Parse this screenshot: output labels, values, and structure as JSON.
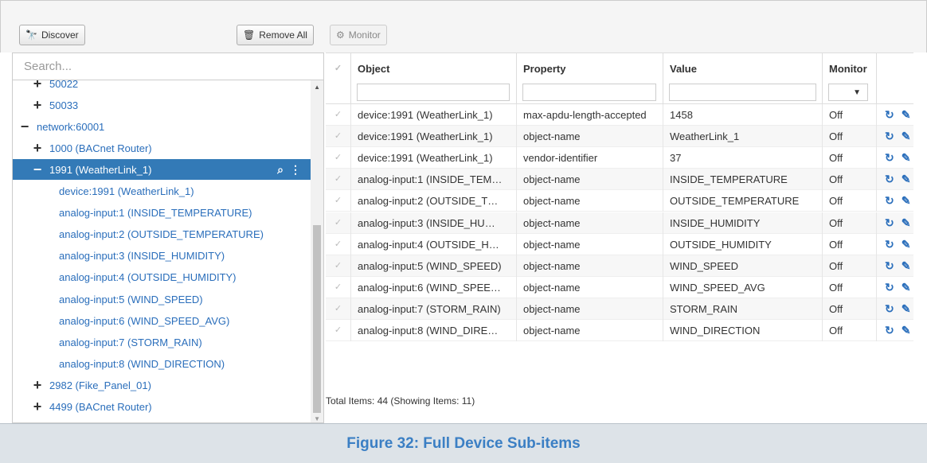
{
  "toolbar": {
    "discover_label": "Discover",
    "remove_all_label": "Remove All",
    "monitor_label": "Monitor"
  },
  "search": {
    "placeholder": "Search..."
  },
  "tree": {
    "items": [
      {
        "label": "50022",
        "type": "plus"
      },
      {
        "label": "50033",
        "type": "plus"
      },
      {
        "label": "network:60001",
        "type": "minus"
      },
      {
        "label": "1000 (BACnet Router)",
        "type": "plus"
      },
      {
        "label": "1991 (WeatherLink_1)",
        "type": "minus",
        "selected": true
      },
      {
        "label": "device:1991 (WeatherLink_1)",
        "type": "leaf"
      },
      {
        "label": "analog-input:1 (INSIDE_TEMPERATURE)",
        "type": "leaf"
      },
      {
        "label": "analog-input:2 (OUTSIDE_TEMPERATURE)",
        "type": "leaf"
      },
      {
        "label": "analog-input:3 (INSIDE_HUMIDITY)",
        "type": "leaf"
      },
      {
        "label": "analog-input:4 (OUTSIDE_HUMIDITY)",
        "type": "leaf"
      },
      {
        "label": "analog-input:5 (WIND_SPEED)",
        "type": "leaf"
      },
      {
        "label": "analog-input:6 (WIND_SPEED_AVG)",
        "type": "leaf"
      },
      {
        "label": "analog-input:7 (STORM_RAIN)",
        "type": "leaf"
      },
      {
        "label": "analog-input:8 (WIND_DIRECTION)",
        "type": "leaf"
      },
      {
        "label": "2982 (Fike_Panel_01)",
        "type": "plus"
      },
      {
        "label": "4499 (BACnet Router)",
        "type": "plus"
      }
    ]
  },
  "grid": {
    "columns": {
      "object": "Object",
      "property": "Property",
      "value": "Value",
      "monitor": "Monitor"
    },
    "rows": [
      {
        "object": "device:1991 (WeatherLink_1)",
        "property": "max-apdu-length-accepted",
        "value": "1458",
        "monitor": "Off"
      },
      {
        "object": "device:1991 (WeatherLink_1)",
        "property": "object-name",
        "value": "WeatherLink_1",
        "monitor": "Off"
      },
      {
        "object": "device:1991 (WeatherLink_1)",
        "property": "vendor-identifier",
        "value": "37",
        "monitor": "Off"
      },
      {
        "object": "analog-input:1 (INSIDE_TEM…",
        "property": "object-name",
        "value": "INSIDE_TEMPERATURE",
        "monitor": "Off"
      },
      {
        "object": "analog-input:2 (OUTSIDE_T…",
        "property": "object-name",
        "value": "OUTSIDE_TEMPERATURE",
        "monitor": "Off"
      },
      {
        "object": "analog-input:3 (INSIDE_HU…",
        "property": "object-name",
        "value": "INSIDE_HUMIDITY",
        "monitor": "Off"
      },
      {
        "object": "analog-input:4 (OUTSIDE_H…",
        "property": "object-name",
        "value": "OUTSIDE_HUMIDITY",
        "monitor": "Off"
      },
      {
        "object": "analog-input:5 (WIND_SPEED)",
        "property": "object-name",
        "value": "WIND_SPEED",
        "monitor": "Off"
      },
      {
        "object": "analog-input:6 (WIND_SPEE…",
        "property": "object-name",
        "value": "WIND_SPEED_AVG",
        "monitor": "Off"
      },
      {
        "object": "analog-input:7 (STORM_RAIN)",
        "property": "object-name",
        "value": "STORM_RAIN",
        "monitor": "Off"
      },
      {
        "object": "analog-input:8 (WIND_DIRE…",
        "property": "object-name",
        "value": "WIND_DIRECTION",
        "monitor": "Off"
      }
    ],
    "footer": "Total Items: 44 (Showing Items: 11)"
  },
  "caption": "Figure 32: Full Device Sub-items",
  "colors": {
    "accent": "#337ab7",
    "link": "#2a6ebb",
    "caption": "#3b7fc4"
  },
  "icons": {
    "discover": "binoculars-icon",
    "remove_all": "trash-icon",
    "monitor": "gears-icon",
    "refresh": "refresh-icon",
    "edit": "pencil-icon"
  }
}
